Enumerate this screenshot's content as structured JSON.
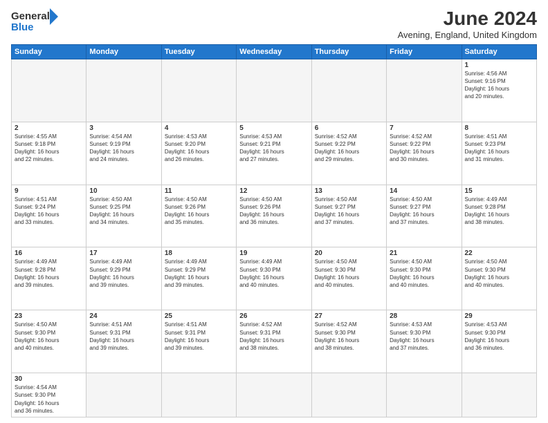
{
  "header": {
    "logo_general": "General",
    "logo_blue": "Blue",
    "month_title": "June 2024",
    "location": "Avening, England, United Kingdom"
  },
  "weekdays": [
    "Sunday",
    "Monday",
    "Tuesday",
    "Wednesday",
    "Thursday",
    "Friday",
    "Saturday"
  ],
  "weeks": [
    [
      {
        "day": "",
        "info": ""
      },
      {
        "day": "",
        "info": ""
      },
      {
        "day": "",
        "info": ""
      },
      {
        "day": "",
        "info": ""
      },
      {
        "day": "",
        "info": ""
      },
      {
        "day": "",
        "info": ""
      },
      {
        "day": "1",
        "info": "Sunrise: 4:56 AM\nSunset: 9:16 PM\nDaylight: 16 hours\nand 20 minutes."
      }
    ],
    [
      {
        "day": "2",
        "info": "Sunrise: 4:55 AM\nSunset: 9:18 PM\nDaylight: 16 hours\nand 22 minutes."
      },
      {
        "day": "3",
        "info": "Sunrise: 4:54 AM\nSunset: 9:19 PM\nDaylight: 16 hours\nand 24 minutes."
      },
      {
        "day": "4",
        "info": "Sunrise: 4:53 AM\nSunset: 9:20 PM\nDaylight: 16 hours\nand 26 minutes."
      },
      {
        "day": "5",
        "info": "Sunrise: 4:53 AM\nSunset: 9:21 PM\nDaylight: 16 hours\nand 27 minutes."
      },
      {
        "day": "6",
        "info": "Sunrise: 4:52 AM\nSunset: 9:22 PM\nDaylight: 16 hours\nand 29 minutes."
      },
      {
        "day": "7",
        "info": "Sunrise: 4:52 AM\nSunset: 9:22 PM\nDaylight: 16 hours\nand 30 minutes."
      },
      {
        "day": "8",
        "info": "Sunrise: 4:51 AM\nSunset: 9:23 PM\nDaylight: 16 hours\nand 31 minutes."
      }
    ],
    [
      {
        "day": "9",
        "info": "Sunrise: 4:51 AM\nSunset: 9:24 PM\nDaylight: 16 hours\nand 33 minutes."
      },
      {
        "day": "10",
        "info": "Sunrise: 4:50 AM\nSunset: 9:25 PM\nDaylight: 16 hours\nand 34 minutes."
      },
      {
        "day": "11",
        "info": "Sunrise: 4:50 AM\nSunset: 9:26 PM\nDaylight: 16 hours\nand 35 minutes."
      },
      {
        "day": "12",
        "info": "Sunrise: 4:50 AM\nSunset: 9:26 PM\nDaylight: 16 hours\nand 36 minutes."
      },
      {
        "day": "13",
        "info": "Sunrise: 4:50 AM\nSunset: 9:27 PM\nDaylight: 16 hours\nand 37 minutes."
      },
      {
        "day": "14",
        "info": "Sunrise: 4:50 AM\nSunset: 9:27 PM\nDaylight: 16 hours\nand 37 minutes."
      },
      {
        "day": "15",
        "info": "Sunrise: 4:49 AM\nSunset: 9:28 PM\nDaylight: 16 hours\nand 38 minutes."
      }
    ],
    [
      {
        "day": "16",
        "info": "Sunrise: 4:49 AM\nSunset: 9:28 PM\nDaylight: 16 hours\nand 39 minutes."
      },
      {
        "day": "17",
        "info": "Sunrise: 4:49 AM\nSunset: 9:29 PM\nDaylight: 16 hours\nand 39 minutes."
      },
      {
        "day": "18",
        "info": "Sunrise: 4:49 AM\nSunset: 9:29 PM\nDaylight: 16 hours\nand 39 minutes."
      },
      {
        "day": "19",
        "info": "Sunrise: 4:49 AM\nSunset: 9:30 PM\nDaylight: 16 hours\nand 40 minutes."
      },
      {
        "day": "20",
        "info": "Sunrise: 4:50 AM\nSunset: 9:30 PM\nDaylight: 16 hours\nand 40 minutes."
      },
      {
        "day": "21",
        "info": "Sunrise: 4:50 AM\nSunset: 9:30 PM\nDaylight: 16 hours\nand 40 minutes."
      },
      {
        "day": "22",
        "info": "Sunrise: 4:50 AM\nSunset: 9:30 PM\nDaylight: 16 hours\nand 40 minutes."
      }
    ],
    [
      {
        "day": "23",
        "info": "Sunrise: 4:50 AM\nSunset: 9:30 PM\nDaylight: 16 hours\nand 40 minutes."
      },
      {
        "day": "24",
        "info": "Sunrise: 4:51 AM\nSunset: 9:31 PM\nDaylight: 16 hours\nand 39 minutes."
      },
      {
        "day": "25",
        "info": "Sunrise: 4:51 AM\nSunset: 9:31 PM\nDaylight: 16 hours\nand 39 minutes."
      },
      {
        "day": "26",
        "info": "Sunrise: 4:52 AM\nSunset: 9:31 PM\nDaylight: 16 hours\nand 38 minutes."
      },
      {
        "day": "27",
        "info": "Sunrise: 4:52 AM\nSunset: 9:30 PM\nDaylight: 16 hours\nand 38 minutes."
      },
      {
        "day": "28",
        "info": "Sunrise: 4:53 AM\nSunset: 9:30 PM\nDaylight: 16 hours\nand 37 minutes."
      },
      {
        "day": "29",
        "info": "Sunrise: 4:53 AM\nSunset: 9:30 PM\nDaylight: 16 hours\nand 36 minutes."
      }
    ],
    [
      {
        "day": "30",
        "info": "Sunrise: 4:54 AM\nSunset: 9:30 PM\nDaylight: 16 hours\nand 36 minutes."
      },
      {
        "day": "",
        "info": ""
      },
      {
        "day": "",
        "info": ""
      },
      {
        "day": "",
        "info": ""
      },
      {
        "day": "",
        "info": ""
      },
      {
        "day": "",
        "info": ""
      },
      {
        "day": "",
        "info": ""
      }
    ]
  ]
}
